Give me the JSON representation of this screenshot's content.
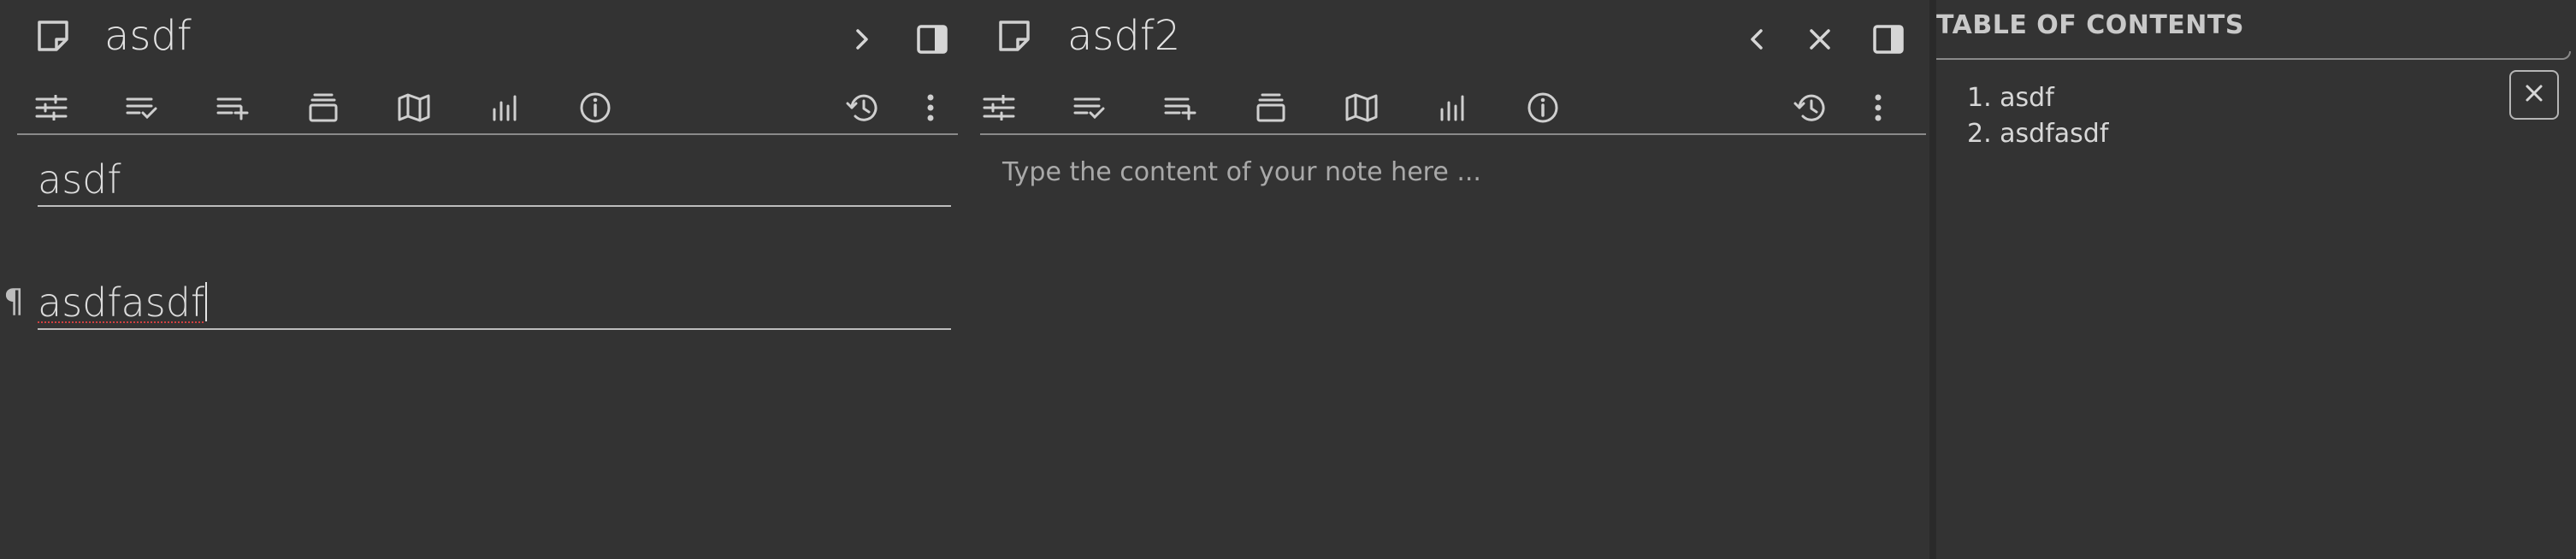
{
  "left_split": {
    "title": "asdf",
    "headings": [
      {
        "text": "asdf"
      },
      {
        "text": "asdfasdf",
        "paragraph_mark": "¶"
      }
    ],
    "ribbon_icons": [
      "options-icon",
      "checklist-icon",
      "add-list-icon",
      "collapse-icon",
      "map-icon",
      "stats-icon",
      "info-icon"
    ],
    "ribbon_right_icons": [
      "history-icon",
      "more-vert-icon"
    ]
  },
  "right_split": {
    "title": "asdf2",
    "placeholder": "Type the content of your note here ...",
    "ribbon_icons": [
      "options-icon",
      "checklist-icon",
      "add-list-icon",
      "collapse-icon",
      "map-icon",
      "stats-icon",
      "info-icon"
    ],
    "ribbon_right_icons": [
      "history-icon",
      "more-vert-icon"
    ]
  },
  "toc": {
    "title": "TABLE OF CONTENTS",
    "items": [
      {
        "number": "1.",
        "label": "asdf"
      },
      {
        "number": "2.",
        "label": "asdfasdf"
      }
    ]
  },
  "colors": {
    "background": "#333333",
    "text": "#d6d6d6",
    "divider": "#8a8a8a",
    "spellcheck": "#d04040"
  }
}
